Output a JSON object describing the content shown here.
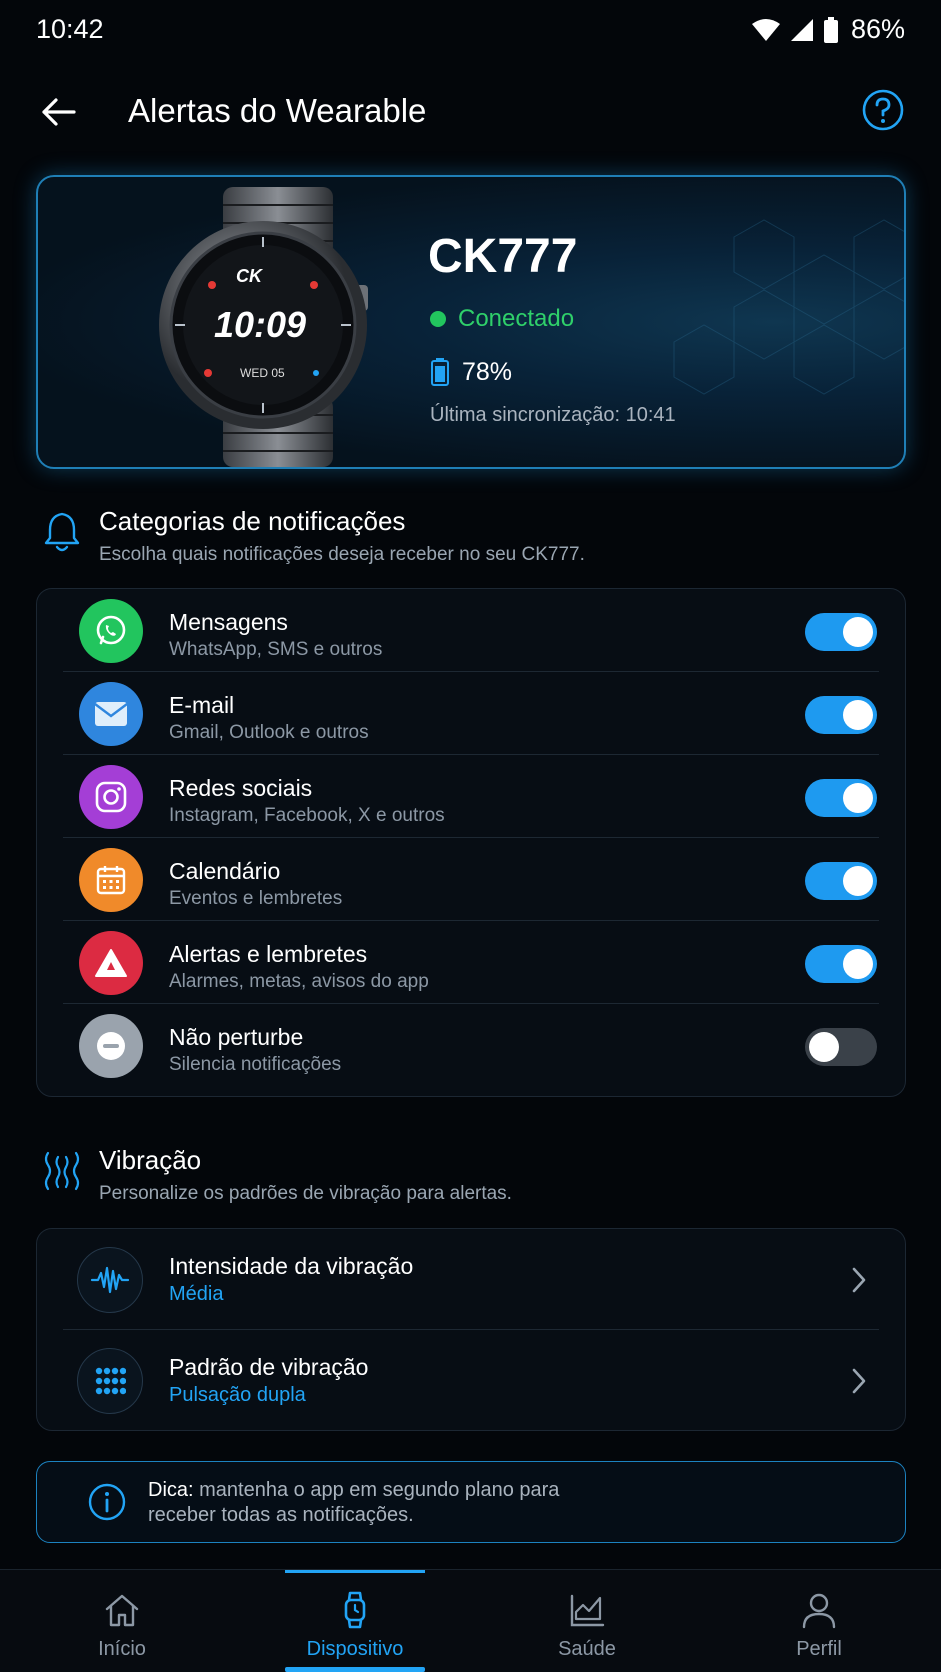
{
  "status_bar": {
    "time": "10:42",
    "battery": "86%"
  },
  "header": {
    "title": "Alertas do Wearable"
  },
  "device": {
    "name": "CK777",
    "status": "Conectado",
    "battery": "78%",
    "last_sync": "Última sincronização: 10:41",
    "watch_face": {
      "brand": "CK",
      "time": "10:09",
      "date": "WED 05"
    }
  },
  "notifications": {
    "title": "Categorias de notificações",
    "subtitle": "Escolha quais notificações deseja receber no seu CK777.",
    "items": [
      {
        "title": "Mensagens",
        "subtitle": "WhatsApp, SMS e outros",
        "enabled": true,
        "icon": "whatsapp-icon",
        "color": "#22c55e"
      },
      {
        "title": "E-mail",
        "subtitle": "Gmail, Outlook e outros",
        "enabled": true,
        "icon": "mail-icon",
        "color": "#2f86de"
      },
      {
        "title": "Redes sociais",
        "subtitle": "Instagram, Facebook, X e outros",
        "enabled": true,
        "icon": "instagram-icon",
        "color": "#a43ed6"
      },
      {
        "title": "Calendário",
        "subtitle": "Eventos e lembretes",
        "enabled": true,
        "icon": "calendar-icon",
        "color": "#f08a2a"
      },
      {
        "title": "Alertas e lembretes",
        "subtitle": "Alarmes, metas, avisos do app",
        "enabled": true,
        "icon": "alert-icon",
        "color": "#dc2b42"
      },
      {
        "title": "Não perturbe",
        "subtitle": "Silencia notificações",
        "enabled": false,
        "icon": "do-not-disturb-icon",
        "color": "#9aa3ad"
      }
    ]
  },
  "vibration": {
    "title": "Vibração",
    "subtitle": "Personalize os padrões de vibração para alertas.",
    "items": [
      {
        "title": "Intensidade da vibração",
        "value": "Média",
        "icon": "waveform-icon"
      },
      {
        "title": "Padrão de vibração",
        "value": "Pulsação dupla",
        "icon": "dots-grid-icon"
      }
    ]
  },
  "tip": {
    "label": "Dica:",
    "text": " mantenha o app em segundo plano para receber todas as notificações."
  },
  "bottom_nav": {
    "items": [
      {
        "label": "Início",
        "icon": "home-icon",
        "active": false
      },
      {
        "label": "Dispositivo",
        "icon": "watch-icon",
        "active": true
      },
      {
        "label": "Saúde",
        "icon": "health-chart-icon",
        "active": false
      },
      {
        "label": "Perfil",
        "icon": "profile-icon",
        "active": false
      }
    ]
  },
  "colors": {
    "accent": "#22a4f5",
    "connected": "#22c55e",
    "background": "#03060a"
  }
}
